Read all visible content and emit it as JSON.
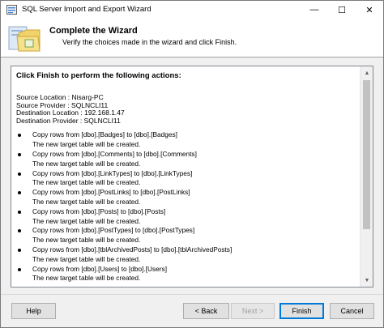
{
  "window": {
    "title": "SQL Server Import and Export Wizard",
    "minimize_glyph": "—",
    "maximize_glyph": "☐",
    "close_glyph": "✕"
  },
  "header": {
    "title": "Complete the Wizard",
    "subtitle": "Verify the choices made in the wizard and click Finish."
  },
  "summary": {
    "heading": "Click Finish to perform the following actions:",
    "source_location": "Source Location : Nisarg-PC",
    "source_provider": "Source Provider : SQLNCLI11",
    "destination_location": "Destination Location : 192.168.1.47",
    "destination_provider": "Destination Provider : SQLNCLI11",
    "actions": [
      {
        "copy": "Copy rows from [dbo].[Badges] to [dbo].[Badges]",
        "note": "The new target table will be created."
      },
      {
        "copy": "Copy rows from [dbo].[Comments] to [dbo].[Comments]",
        "note": "The new target table will be created."
      },
      {
        "copy": "Copy rows from [dbo].[LinkTypes] to [dbo].[LinkTypes]",
        "note": "The new target table will be created."
      },
      {
        "copy": "Copy rows from [dbo].[PostLinks] to [dbo].[PostLinks]",
        "note": "The new target table will be created."
      },
      {
        "copy": "Copy rows from [dbo].[Posts] to [dbo].[Posts]",
        "note": "The new target table will be created."
      },
      {
        "copy": "Copy rows from [dbo].[PostTypes] to [dbo].[PostTypes]",
        "note": "The new target table will be created."
      },
      {
        "copy": "Copy rows from [dbo].[tblArchivedPosts] to [dbo].[tblArchivedPosts]",
        "note": "The new target table will be created."
      },
      {
        "copy": "Copy rows from [dbo].[Users] to [dbo].[Users]",
        "note": "The new target table will be created."
      }
    ]
  },
  "buttons": {
    "help": "Help",
    "back": "< Back",
    "next": "Next >",
    "finish": "Finish",
    "cancel": "Cancel"
  },
  "icons": {
    "app": "sql-wizard-app-icon",
    "header": "wizard-folder-icon",
    "scroll_up": "▲",
    "scroll_down": "▼"
  },
  "colors": {
    "accent_default_button": "#0078d7",
    "window_bg": "#f0f0f0"
  }
}
